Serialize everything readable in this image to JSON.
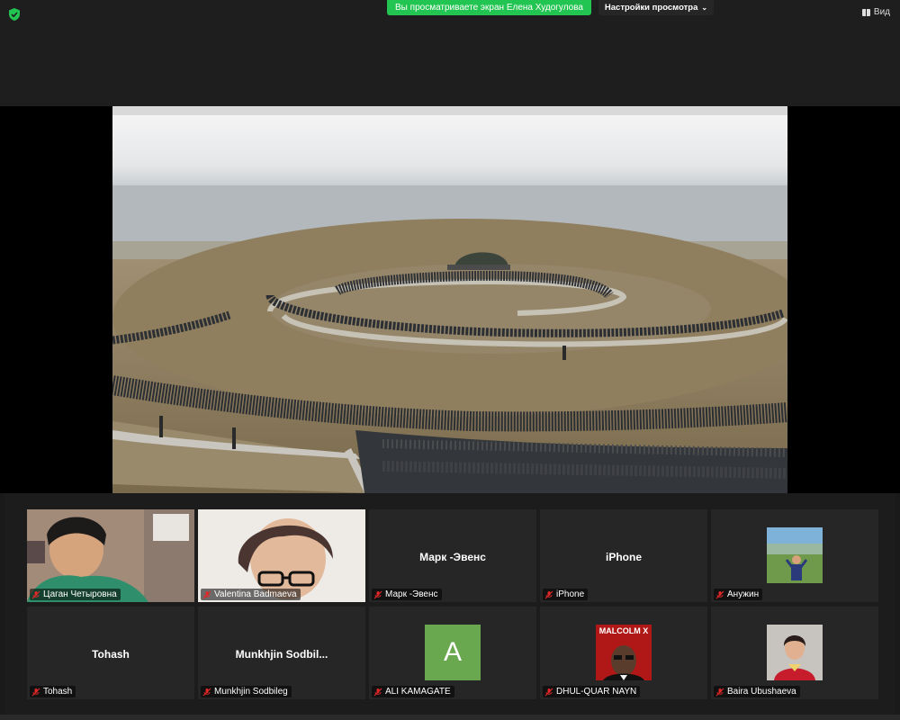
{
  "header": {
    "share_banner": "Вы просматриваете экран Елена Худогулова",
    "view_settings": "Настройки просмотра",
    "view_button": "Вид"
  },
  "participants": [
    {
      "name": "Цаган Четыровна",
      "display": "video"
    },
    {
      "name": "Valentina Badmaeva",
      "display": "video"
    },
    {
      "name": "Марк -Эвенс",
      "display": "name",
      "center_text": "Марк -Эвенс"
    },
    {
      "name": "iPhone",
      "display": "name",
      "center_text": "iPhone"
    },
    {
      "name": "Анужин",
      "display": "avatar"
    },
    {
      "name": "Tohash",
      "display": "name",
      "center_text": "Tohash"
    },
    {
      "name": "Munkhjin Sodbileg",
      "display": "name",
      "center_text": "Munkhjin  Sodbil..."
    },
    {
      "name": "ALI KAMAGATE",
      "display": "letter",
      "letter": "A"
    },
    {
      "name": "DHUL-QUAR NAYN",
      "display": "avatar",
      "avatar_text": "MALCOLM X"
    },
    {
      "name": "Baira Ubushaeva",
      "display": "avatar"
    }
  ],
  "colors": {
    "share_banner_bg": "#23c552",
    "muted_icon": "#e02828",
    "letter_avatar_bg": "#6aa84f"
  }
}
